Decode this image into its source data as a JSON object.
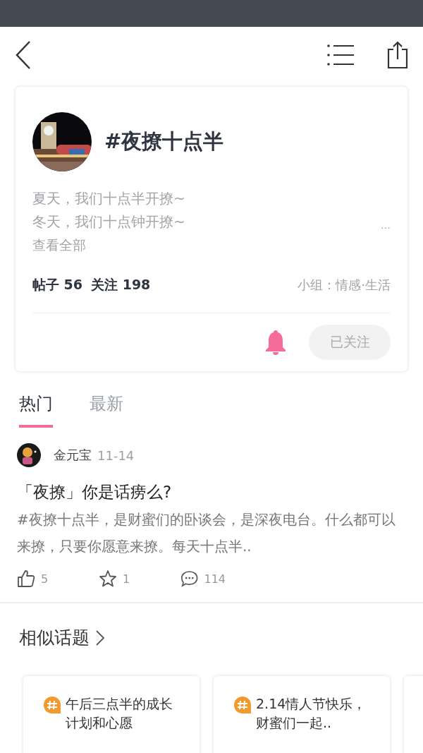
{
  "topic": {
    "title": "#夜撩十点半",
    "description": [
      "夏天，我们十点半开撩~",
      "冬天，我们十点钟开撩~"
    ],
    "more": "…",
    "view_all": "查看全部",
    "stats": [
      {
        "label": "帖子",
        "value": "56"
      },
      {
        "label": "关注",
        "value": "198"
      }
    ],
    "group": "小组：情感·生活",
    "follow": {
      "label": "已关注",
      "following": true
    }
  },
  "tabs": [
    {
      "label": "热门",
      "selected": true
    },
    {
      "label": "最新",
      "selected": false
    }
  ],
  "posts": [
    {
      "author": "金元宝",
      "date": "11-14",
      "title": "「夜撩」你是话痨么?",
      "body": "#夜撩十点半，是财蜜们的卧谈会，是深夜电台。什么都可以来撩，只要你愿意来撩。每天十点半..",
      "likes": "5",
      "favorites": "1",
      "comments": "114"
    }
  ],
  "similar": {
    "title": "相似话题",
    "items": [
      {
        "name": "午后三点半的成长计划和心愿"
      },
      {
        "name": "2.14情人节快乐，财蜜们一起.."
      }
    ]
  }
}
